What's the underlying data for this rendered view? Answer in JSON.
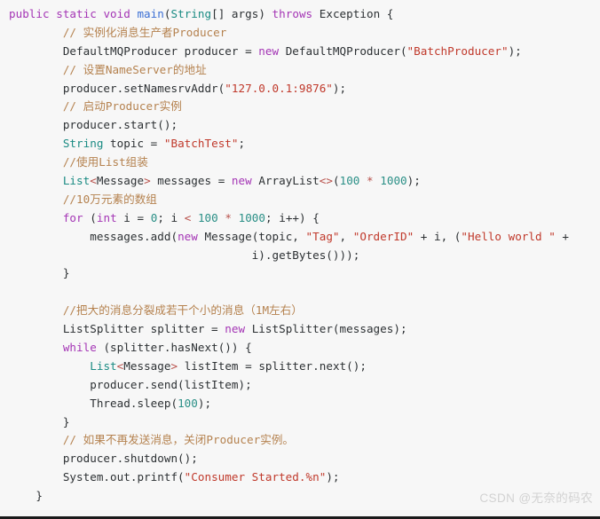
{
  "editor": {
    "background_color": "#f7f7f7",
    "language": "java",
    "theme_colors": {
      "keyword": "#a435b5",
      "type": "#1a8b83",
      "method": "#3b6fd4",
      "string": "#c0392b",
      "number": "#2a8f86",
      "comment": "#b5824f",
      "operator": "#b8504a",
      "plain": "#2c3033"
    }
  },
  "watermark": {
    "text": "CSDN @无奈的码农",
    "color": "#d2d2d2"
  },
  "code": {
    "lines": [
      "public static void main(String[] args) throws Exception {",
      "        // 实例化消息生产者Producer",
      "        DefaultMQProducer producer = new DefaultMQProducer(\"BatchProducer\");",
      "        // 设置NameServer的地址",
      "        producer.setNamesrvAddr(\"127.0.0.1:9876\");",
      "        // 启动Producer实例",
      "        producer.start();",
      "        String topic = \"BatchTest\";",
      "        //使用List组装",
      "        List<Message> messages = new ArrayList<>(100 * 1000);",
      "        //10万元素的数组",
      "        for (int i = 0; i < 100 * 1000; i++) {",
      "            messages.add(new Message(topic, \"Tag\", \"OrderID\" + i, (\"Hello world \" +",
      "                                    i).getBytes()));",
      "        }",
      "",
      "        //把大的消息分裂成若干个小的消息（1M左右）",
      "        ListSplitter splitter = new ListSplitter(messages);",
      "        while (splitter.hasNext()) {",
      "            List<Message> listItem = splitter.next();",
      "            producer.send(listItem);",
      "            Thread.sleep(100);",
      "        }",
      "        // 如果不再发送消息，关闭Producer实例。",
      "        producer.shutdown();",
      "        System.out.printf(\"Consumer Started.%n\");",
      "    }"
    ],
    "line_tokens": [
      [
        [
          "public ",
          "kw"
        ],
        [
          "static ",
          "kw"
        ],
        [
          "void ",
          "kw"
        ],
        [
          "main",
          "fn"
        ],
        [
          "(",
          "pln"
        ],
        [
          "String",
          "typ"
        ],
        [
          "[] args) ",
          "pln"
        ],
        [
          "throws ",
          "kw"
        ],
        [
          "Exception {",
          "pln"
        ]
      ],
      [
        [
          "        ",
          "pln"
        ],
        [
          "// 实例化消息生产者Producer",
          "cmt"
        ]
      ],
      [
        [
          "        DefaultMQProducer producer = ",
          "pln"
        ],
        [
          "new ",
          "kw"
        ],
        [
          "DefaultMQProducer(",
          "pln"
        ],
        [
          "\"BatchProducer\"",
          "str"
        ],
        [
          ");",
          "pln"
        ]
      ],
      [
        [
          "        ",
          "pln"
        ],
        [
          "// 设置NameServer的地址",
          "cmt"
        ]
      ],
      [
        [
          "        producer.setNamesrvAddr(",
          "pln"
        ],
        [
          "\"127.0.0.1:9876\"",
          "str"
        ],
        [
          ");",
          "pln"
        ]
      ],
      [
        [
          "        ",
          "pln"
        ],
        [
          "// 启动Producer实例",
          "cmt"
        ]
      ],
      [
        [
          "        producer.start();",
          "pln"
        ]
      ],
      [
        [
          "        ",
          "pln"
        ],
        [
          "String ",
          "typ"
        ],
        [
          "topic = ",
          "pln"
        ],
        [
          "\"BatchTest\"",
          "str"
        ],
        [
          ";",
          "pln"
        ]
      ],
      [
        [
          "        ",
          "pln"
        ],
        [
          "//使用List组装",
          "cmt"
        ]
      ],
      [
        [
          "        ",
          "pln"
        ],
        [
          "List",
          "typ"
        ],
        [
          "<",
          "op"
        ],
        [
          "Message",
          "pln"
        ],
        [
          "> ",
          "op"
        ],
        [
          "messages = ",
          "pln"
        ],
        [
          "new ",
          "kw"
        ],
        [
          "ArrayList",
          "pln"
        ],
        [
          "<>",
          "op"
        ],
        [
          "(",
          "pln"
        ],
        [
          "100",
          "num"
        ],
        [
          " ",
          "pln"
        ],
        [
          "*",
          "op"
        ],
        [
          " ",
          "pln"
        ],
        [
          "1000",
          "num"
        ],
        [
          ");",
          "pln"
        ]
      ],
      [
        [
          "        ",
          "pln"
        ],
        [
          "//10万元素的数组",
          "cmt"
        ]
      ],
      [
        [
          "        ",
          "pln"
        ],
        [
          "for ",
          "kw"
        ],
        [
          "(",
          "pln"
        ],
        [
          "int ",
          "kw"
        ],
        [
          "i = ",
          "pln"
        ],
        [
          "0",
          "num"
        ],
        [
          "; i ",
          "pln"
        ],
        [
          "<",
          "op"
        ],
        [
          " ",
          "pln"
        ],
        [
          "100",
          "num"
        ],
        [
          " ",
          "pln"
        ],
        [
          "*",
          "op"
        ],
        [
          " ",
          "pln"
        ],
        [
          "1000",
          "num"
        ],
        [
          "; i++) {",
          "pln"
        ]
      ],
      [
        [
          "            messages.add(",
          "pln"
        ],
        [
          "new ",
          "kw"
        ],
        [
          "Message(topic, ",
          "pln"
        ],
        [
          "\"Tag\"",
          "str"
        ],
        [
          ", ",
          "pln"
        ],
        [
          "\"OrderID\"",
          "str"
        ],
        [
          " + i, (",
          "pln"
        ],
        [
          "\"Hello world \"",
          "str"
        ],
        [
          " +",
          "pln"
        ]
      ],
      [
        [
          "                                    i).getBytes()));",
          "pln"
        ]
      ],
      [
        [
          "        }",
          "pln"
        ]
      ],
      [
        [
          "",
          "pln"
        ]
      ],
      [
        [
          "        ",
          "pln"
        ],
        [
          "//把大的消息分裂成若干个小的消息（1M左右）",
          "cmt"
        ]
      ],
      [
        [
          "        ListSplitter splitter = ",
          "pln"
        ],
        [
          "new ",
          "kw"
        ],
        [
          "ListSplitter(messages);",
          "pln"
        ]
      ],
      [
        [
          "        ",
          "pln"
        ],
        [
          "while ",
          "kw"
        ],
        [
          "(splitter.hasNext()) {",
          "pln"
        ]
      ],
      [
        [
          "            ",
          "pln"
        ],
        [
          "List",
          "typ"
        ],
        [
          "<",
          "op"
        ],
        [
          "Message",
          "pln"
        ],
        [
          "> ",
          "op"
        ],
        [
          "listItem = splitter.next();",
          "pln"
        ]
      ],
      [
        [
          "            producer.send(listItem);",
          "pln"
        ]
      ],
      [
        [
          "            Thread.sleep(",
          "pln"
        ],
        [
          "100",
          "num"
        ],
        [
          ");",
          "pln"
        ]
      ],
      [
        [
          "        }",
          "pln"
        ]
      ],
      [
        [
          "        ",
          "pln"
        ],
        [
          "// 如果不再发送消息，关闭Producer实例。",
          "cmt"
        ]
      ],
      [
        [
          "        producer.shutdown();",
          "pln"
        ]
      ],
      [
        [
          "        System.out.printf(",
          "pln"
        ],
        [
          "\"Consumer Started.%n\"",
          "str"
        ],
        [
          ");",
          "pln"
        ]
      ],
      [
        [
          "    }",
          "pln"
        ]
      ]
    ]
  }
}
